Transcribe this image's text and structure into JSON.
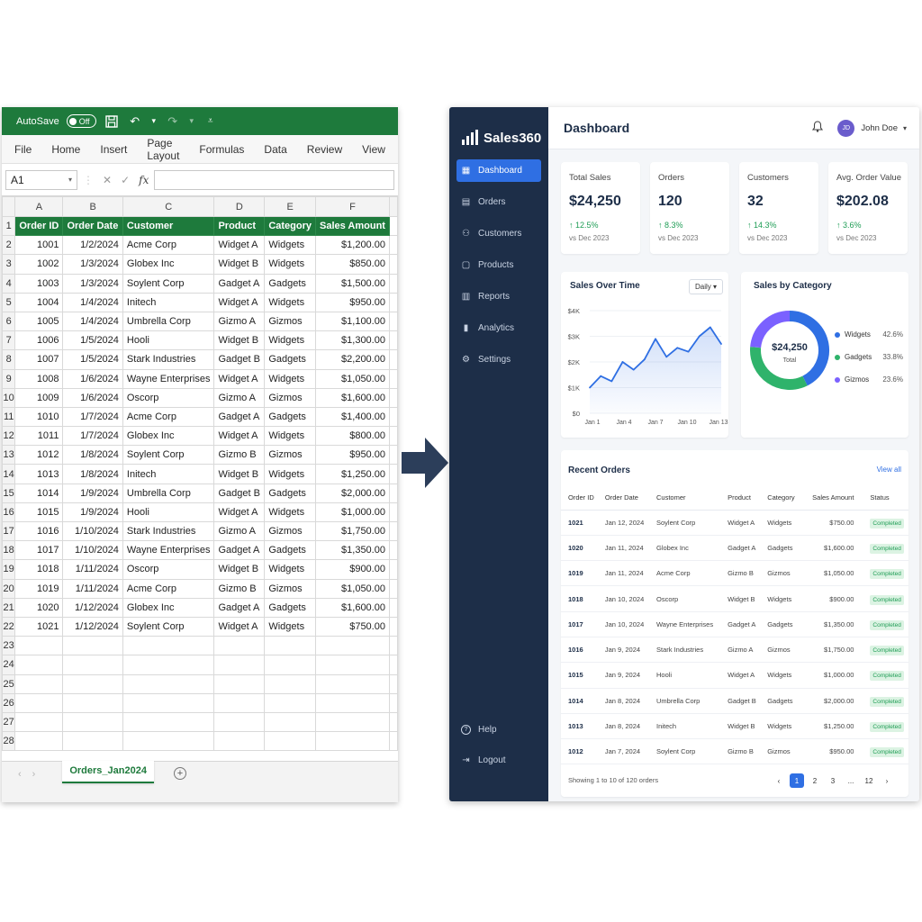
{
  "excel": {
    "autosave_label": "AutoSave",
    "autosave_state": "Off",
    "menu": [
      "File",
      "Home",
      "Insert",
      "Page Layout",
      "Formulas",
      "Data",
      "Review",
      "View"
    ],
    "name_box": "A1",
    "columns": [
      "A",
      "B",
      "C",
      "D",
      "E",
      "F"
    ],
    "headers": [
      "Order ID",
      "Order Date",
      "Customer",
      "Product",
      "Category",
      "Sales Amount"
    ],
    "rows": [
      [
        "1001",
        "1/2/2024",
        "Acme Corp",
        "Widget A",
        "Widgets",
        "$1,200.00"
      ],
      [
        "1002",
        "1/3/2024",
        "Globex Inc",
        "Widget B",
        "Widgets",
        "$850.00"
      ],
      [
        "1003",
        "1/3/2024",
        "Soylent Corp",
        "Gadget A",
        "Gadgets",
        "$1,500.00"
      ],
      [
        "1004",
        "1/4/2024",
        "Initech",
        "Widget A",
        "Widgets",
        "$950.00"
      ],
      [
        "1005",
        "1/4/2024",
        "Umbrella Corp",
        "Gizmo A",
        "Gizmos",
        "$1,100.00"
      ],
      [
        "1006",
        "1/5/2024",
        "Hooli",
        "Widget B",
        "Widgets",
        "$1,300.00"
      ],
      [
        "1007",
        "1/5/2024",
        "Stark Industries",
        "Gadget B",
        "Gadgets",
        "$2,200.00"
      ],
      [
        "1008",
        "1/6/2024",
        "Wayne Enterprises",
        "Widget A",
        "Widgets",
        "$1,050.00"
      ],
      [
        "1009",
        "1/6/2024",
        "Oscorp",
        "Gizmo A",
        "Gizmos",
        "$1,600.00"
      ],
      [
        "1010",
        "1/7/2024",
        "Acme Corp",
        "Gadget A",
        "Gadgets",
        "$1,400.00"
      ],
      [
        "1011",
        "1/7/2024",
        "Globex Inc",
        "Widget A",
        "Widgets",
        "$800.00"
      ],
      [
        "1012",
        "1/8/2024",
        "Soylent Corp",
        "Gizmo B",
        "Gizmos",
        "$950.00"
      ],
      [
        "1013",
        "1/8/2024",
        "Initech",
        "Widget B",
        "Widgets",
        "$1,250.00"
      ],
      [
        "1014",
        "1/9/2024",
        "Umbrella Corp",
        "Gadget B",
        "Gadgets",
        "$2,000.00"
      ],
      [
        "1015",
        "1/9/2024",
        "Hooli",
        "Widget A",
        "Widgets",
        "$1,000.00"
      ],
      [
        "1016",
        "1/10/2024",
        "Stark Industries",
        "Gizmo A",
        "Gizmos",
        "$1,750.00"
      ],
      [
        "1017",
        "1/10/2024",
        "Wayne Enterprises",
        "Gadget A",
        "Gadgets",
        "$1,350.00"
      ],
      [
        "1018",
        "1/11/2024",
        "Oscorp",
        "Widget B",
        "Widgets",
        "$900.00"
      ],
      [
        "1019",
        "1/11/2024",
        "Acme Corp",
        "Gizmo B",
        "Gizmos",
        "$1,050.00"
      ],
      [
        "1020",
        "1/12/2024",
        "Globex Inc",
        "Gadget A",
        "Gadgets",
        "$1,600.00"
      ],
      [
        "1021",
        "1/12/2024",
        "Soylent Corp",
        "Widget A",
        "Widgets",
        "$750.00"
      ]
    ],
    "row_numbers": [
      "1",
      "2",
      "3",
      "4",
      "5",
      "6",
      "7",
      "8",
      "9",
      "10",
      "11",
      "12",
      "13",
      "14",
      "15",
      "16",
      "17",
      "18",
      "19",
      "20",
      "21",
      "22",
      "23",
      "24",
      "25",
      "26",
      "27",
      "28"
    ],
    "sheet_tab": "Orders_Jan2024",
    "accent": "#1e7a3c"
  },
  "dashboard": {
    "brand": "Sales360",
    "title": "Dashboard",
    "user": {
      "initials": "JD",
      "name": "John Doe"
    },
    "nav": [
      {
        "label": "Dashboard",
        "icon": "grid-icon"
      },
      {
        "label": "Orders",
        "icon": "orders-icon"
      },
      {
        "label": "Customers",
        "icon": "users-icon"
      },
      {
        "label": "Products",
        "icon": "box-icon"
      },
      {
        "label": "Reports",
        "icon": "report-icon"
      },
      {
        "label": "Analytics",
        "icon": "bar-chart-icon"
      },
      {
        "label": "Settings",
        "icon": "gear-icon"
      }
    ],
    "nav_bottom": [
      {
        "label": "Help",
        "icon": "help-icon"
      },
      {
        "label": "Logout",
        "icon": "logout-icon"
      }
    ],
    "cards": [
      {
        "label": "Total Sales",
        "value": "$24,250",
        "change": "12.5%",
        "vs": "vs Dec 2023"
      },
      {
        "label": "Orders",
        "value": "120",
        "change": "8.3%",
        "vs": "vs Dec 2023"
      },
      {
        "label": "Customers",
        "value": "32",
        "change": "14.3%",
        "vs": "vs Dec 2023"
      },
      {
        "label": "Avg. Order Value",
        "value": "$202.08",
        "change": "3.6%",
        "vs": "vs Dec 2023"
      }
    ],
    "sales_over_time": {
      "title": "Sales Over Time",
      "period": "Daily"
    },
    "sales_by_category": {
      "title": "Sales by Category",
      "center_value": "$24,250",
      "center_label": "Total"
    },
    "recent_orders": {
      "title": "Recent Orders",
      "view_all": "View all",
      "columns": [
        "Order ID",
        "Order Date",
        "Customer",
        "Product",
        "Category",
        "Sales Amount",
        "Status"
      ],
      "rows": [
        [
          "1021",
          "Jan 12, 2024",
          "Soylent Corp",
          "Widget A",
          "Widgets",
          "$750.00",
          "Completed"
        ],
        [
          "1020",
          "Jan 11, 2024",
          "Globex Inc",
          "Gadget A",
          "Gadgets",
          "$1,600.00",
          "Completed"
        ],
        [
          "1019",
          "Jan 11, 2024",
          "Acme Corp",
          "Gizmo B",
          "Gizmos",
          "$1,050.00",
          "Completed"
        ],
        [
          "1018",
          "Jan 10, 2024",
          "Oscorp",
          "Widget B",
          "Widgets",
          "$900.00",
          "Completed"
        ],
        [
          "1017",
          "Jan 10, 2024",
          "Wayne Enterprises",
          "Gadget A",
          "Gadgets",
          "$1,350.00",
          "Completed"
        ],
        [
          "1016",
          "Jan 9, 2024",
          "Stark Industries",
          "Gizmo A",
          "Gizmos",
          "$1,750.00",
          "Completed"
        ],
        [
          "1015",
          "Jan 9, 2024",
          "Hooli",
          "Widget A",
          "Widgets",
          "$1,000.00",
          "Completed"
        ],
        [
          "1014",
          "Jan 8, 2024",
          "Umbrella Corp",
          "Gadget B",
          "Gadgets",
          "$2,000.00",
          "Completed"
        ],
        [
          "1013",
          "Jan 8, 2024",
          "Initech",
          "Widget B",
          "Widgets",
          "$1,250.00",
          "Completed"
        ],
        [
          "1012",
          "Jan 7, 2024",
          "Soylent Corp",
          "Gizmo B",
          "Gizmos",
          "$950.00",
          "Completed"
        ]
      ],
      "showing": "Showing 1 to 10 of 120 orders",
      "pages": [
        "1",
        "2",
        "3",
        "...",
        "12"
      ],
      "prev": "‹",
      "next": "›"
    },
    "colors": {
      "sidebar": "#1d2e48",
      "accent": "#2f6fe3",
      "success": "#1f9d55"
    }
  },
  "chart_data": [
    {
      "type": "area",
      "title": "Sales Over Time",
      "x_tick_labels": [
        "Jan 1",
        "Jan 4",
        "Jan 7",
        "Jan 10",
        "Jan 13"
      ],
      "y_tick_labels": [
        "$0",
        "$1K",
        "$2K",
        "$3K",
        "$4K"
      ],
      "ylim": [
        0,
        4000
      ],
      "xlim": [
        1,
        13
      ],
      "x": [
        1,
        2,
        3,
        4,
        5,
        6,
        7,
        8,
        9,
        10,
        11,
        12,
        13
      ],
      "values": [
        1000,
        1450,
        1250,
        2000,
        1700,
        2100,
        2900,
        2200,
        2550,
        2400,
        3000,
        3350,
        2700
      ]
    },
    {
      "type": "pie",
      "title": "Sales by Category",
      "categories": [
        "Widgets",
        "Gadgets",
        "Gizmos"
      ],
      "values": [
        42.6,
        33.8,
        23.6
      ],
      "labels": [
        "42.6%",
        "33.8%",
        "23.6%"
      ],
      "colors": [
        "#2f6fe3",
        "#2fb36b",
        "#7b61ff"
      ]
    }
  ]
}
